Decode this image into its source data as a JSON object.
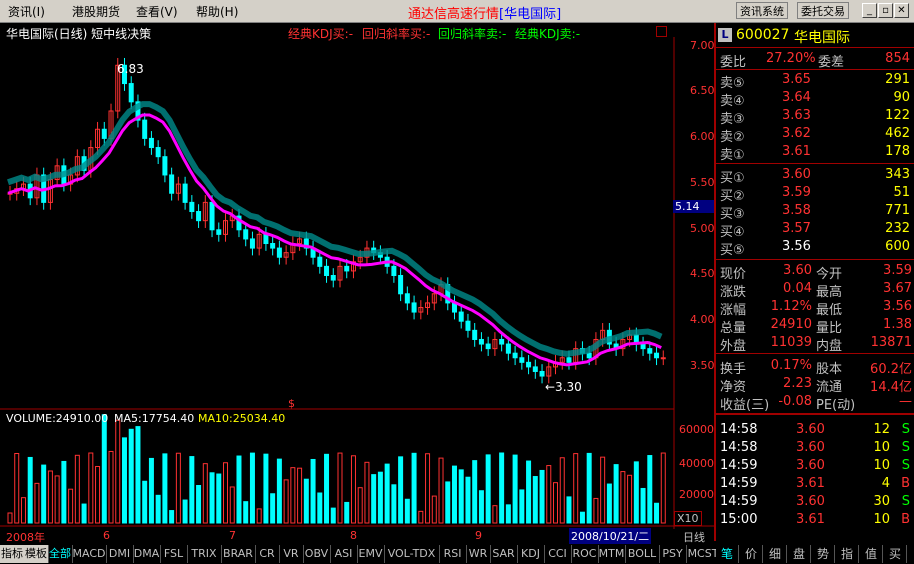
{
  "menu": {
    "items": [
      "资讯(I)",
      "港股期货",
      "查看(V)",
      "帮助(H)"
    ],
    "title_main": "通达信高速行情",
    "title_bracket": "[华电国际]",
    "btn1": "资讯系统",
    "btn2": "委托交易"
  },
  "chart_header": {
    "name": "华电国际(日线) 短中线决策",
    "sig1": "经典KDJ买:-",
    "sig2": "回归斜率买:-",
    "sig3": "回归斜率卖:-",
    "sig4": "经典KDJ卖:-"
  },
  "price_axis": [
    "7.00",
    "6.50",
    "6.00",
    "5.50",
    "5.00",
    "4.50",
    "4.00",
    "3.50"
  ],
  "current_price_tag": "5.14",
  "annotations": {
    "high": "6.83",
    "low": "←3.30",
    "dollar": "$"
  },
  "volume_header": {
    "vol": "VOLUME:24910.00",
    "ma5": "MA5:17754.40",
    "ma10": "MA10:25034.40"
  },
  "volume_axis": [
    "60000",
    "40000",
    "20000"
  ],
  "volume_unit": "X10",
  "time_axis": {
    "year": "2008年",
    "m6": "6",
    "m7": "7",
    "m8": "8",
    "m9": "9",
    "date": "2008/10/21/二",
    "period": "日线"
  },
  "quote": {
    "code": "600027",
    "name": "华电国际",
    "webi_label": "委比",
    "webi": "27.20%",
    "wecha_label": "委差",
    "wecha": "854",
    "asks": [
      {
        "label": "卖⑤",
        "price": "3.65",
        "vol": "291"
      },
      {
        "label": "卖④",
        "price": "3.64",
        "vol": "90"
      },
      {
        "label": "卖③",
        "price": "3.63",
        "vol": "122"
      },
      {
        "label": "卖②",
        "price": "3.62",
        "vol": "462"
      },
      {
        "label": "卖①",
        "price": "3.61",
        "vol": "178"
      }
    ],
    "bids": [
      {
        "label": "买①",
        "price": "3.60",
        "vol": "343"
      },
      {
        "label": "买②",
        "price": "3.59",
        "vol": "51"
      },
      {
        "label": "买③",
        "price": "3.58",
        "vol": "771"
      },
      {
        "label": "买④",
        "price": "3.57",
        "vol": "232"
      },
      {
        "label": "买⑤",
        "price": "3.56",
        "vol": "600"
      }
    ],
    "stats": [
      {
        "l1": "现价",
        "v1": "3.60",
        "l2": "今开",
        "v2": "3.59"
      },
      {
        "l1": "涨跌",
        "v1": "0.04",
        "l2": "最高",
        "v2": "3.67"
      },
      {
        "l1": "涨幅",
        "v1": "1.12%",
        "l2": "最低",
        "v2": "3.56"
      },
      {
        "l1": "总量",
        "v1": "24910",
        "l2": "量比",
        "v2": "1.38"
      },
      {
        "l1": "外盘",
        "v1": "11039",
        "l2": "内盘",
        "v2": "13871"
      }
    ],
    "stats2": [
      {
        "l1": "换手",
        "v1": "0.17%",
        "l2": "股本",
        "v2": "60.2亿"
      },
      {
        "l1": "净资",
        "v1": "2.23",
        "l2": "流通",
        "v2": "14.4亿"
      },
      {
        "l1": "收益(三)",
        "v1": "-0.08",
        "l2": "PE(动)",
        "v2": "—"
      }
    ],
    "ticks": [
      {
        "t": "14:58",
        "p": "3.60",
        "v": "12",
        "s": "S"
      },
      {
        "t": "14:58",
        "p": "3.60",
        "v": "10",
        "s": "S"
      },
      {
        "t": "14:59",
        "p": "3.60",
        "v": "10",
        "s": "S"
      },
      {
        "t": "14:59",
        "p": "3.61",
        "v": "4",
        "s": "B"
      },
      {
        "t": "14:59",
        "p": "3.60",
        "v": "30",
        "s": "S"
      },
      {
        "t": "15:00",
        "p": "3.61",
        "v": "10",
        "s": "B"
      }
    ]
  },
  "bottom_tabs": [
    "指标",
    "模板",
    "全部",
    "MACD",
    "DMI",
    "DMA",
    "FSL",
    "TRIX",
    "BRAR",
    "CR",
    "VR",
    "OBV",
    "ASI",
    "EMV",
    "VOL-TDX",
    "RSI",
    "WR",
    "SAR",
    "KDJ",
    "CCI",
    "ROC",
    "MTM",
    "BOLL",
    "PSY",
    "MCST"
  ],
  "right_tabs": [
    "笔",
    "价",
    "细",
    "盘",
    "势",
    "指",
    "值",
    "买"
  ],
  "colors": {
    "up": "#ff3232",
    "down": "#00ffff",
    "green": "#00ff00",
    "yellow": "#ffff00",
    "magenta": "#ff00ff"
  }
}
